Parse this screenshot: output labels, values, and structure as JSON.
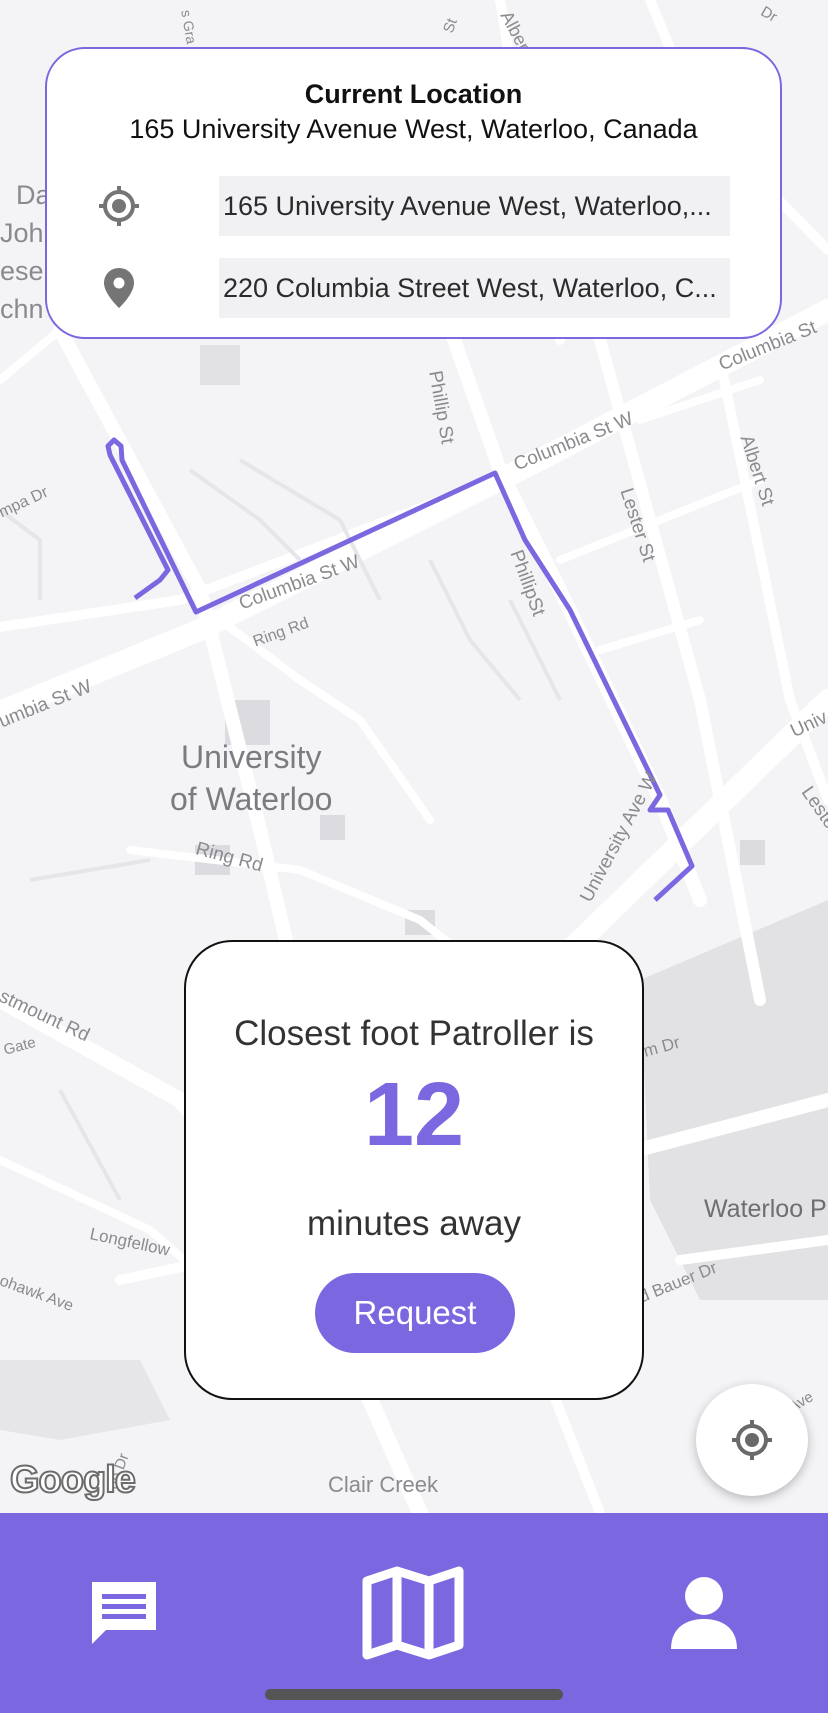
{
  "map": {
    "labels": {
      "phillip_st_top": "Phillip St",
      "columbia_st_w_top": "Columbia St W",
      "columbia_st_right": "Columbia St",
      "albert_st": "Albert St",
      "lester_st": "Lester St",
      "phillip_st_mid": "PhillipSt",
      "columbia_st_w_route": "Columbia St W",
      "ring_rd_top": "Ring Rd",
      "columbia_st_w_left": "umbia St W",
      "ampa_dr": "mpa Dr",
      "university_of_waterloo": "University\nof Waterloo",
      "ring_rd_bottom": "Ring Rd",
      "university_ave_w": "University Ave W",
      "univ_right": "Univ",
      "lest_right": "Leste",
      "westmount_rd": "stmount Rd",
      "gate": "Gate",
      "m_dr": "m Dr",
      "waterloo_park": "Waterloo P",
      "bauer_dr": "d Bauer Dr",
      "longfellow": "Longfellow",
      "mohawk_ave": "ohawk Ave",
      "ave_right": "Ave",
      "ridge_dr": "ge Dr",
      "clair_creek": "Clair Creek",
      "top_grad": "s Gra",
      "top_albert": "Albert",
      "top_dr": "Dr",
      "top_st": "St",
      "da": "Da",
      "john": "Joh",
      "ese": "ese",
      "chn": "chn"
    },
    "route_color": "#7b68e0",
    "attribution": "Google"
  },
  "location_card": {
    "title": "Current Location",
    "address": "165 University Avenue West, Waterloo, Canada",
    "origin_value": "165 University Avenue West, Waterloo,...",
    "destination_value": "220 Columbia Street West, Waterloo, C..."
  },
  "patroller_card": {
    "line1": "Closest foot Patroller is",
    "minutes": "12",
    "line2": "minutes away",
    "request_label": "Request"
  },
  "icons": {
    "origin": "crosshair-icon",
    "destination": "map-pin-icon",
    "locate": "my-location-icon",
    "tab_chat": "chat-icon",
    "tab_map": "map-icon",
    "tab_profile": "person-icon"
  },
  "colors": {
    "accent": "#7b68e0",
    "map_bg": "#f4f3f6"
  }
}
